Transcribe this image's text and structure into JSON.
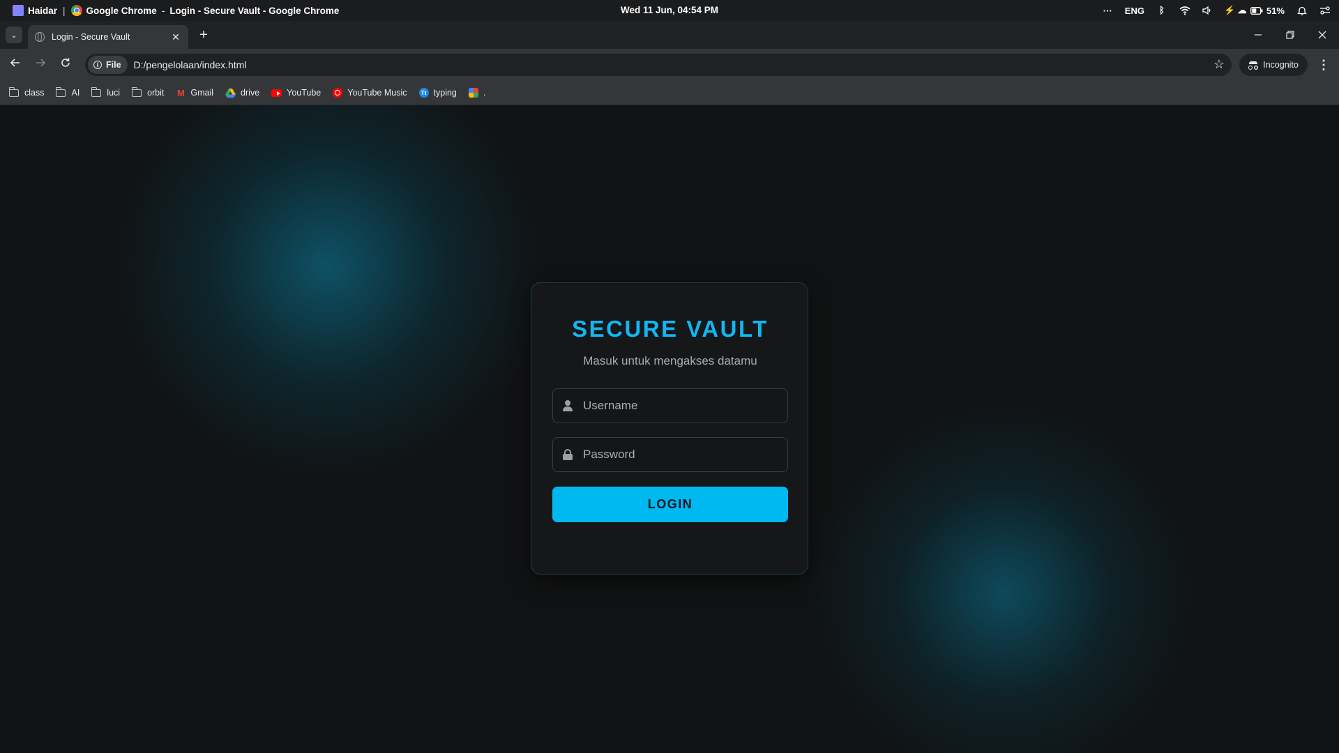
{
  "system_bar": {
    "user": "Haidar",
    "separator": "|",
    "app_name": "Google Chrome",
    "window_title": "Login - Secure Vault - Google Chrome",
    "datetime": "Wed 11 Jun, 04:54 PM",
    "overflow": "···",
    "language": "ENG",
    "battery": "51%"
  },
  "tabs": [
    {
      "title": "Login - Secure Vault",
      "active": true
    }
  ],
  "toolbar": {
    "site_chip": "File",
    "url": "D:/pengelolaan/index.html",
    "incognito_label": "Incognito"
  },
  "bookmarks": [
    {
      "label": "class",
      "icon": "folder-icon"
    },
    {
      "label": "AI",
      "icon": "folder-icon"
    },
    {
      "label": "luci",
      "icon": "folder-icon"
    },
    {
      "label": "orbit",
      "icon": "folder-icon"
    },
    {
      "label": "Gmail",
      "icon": "gmail-icon"
    },
    {
      "label": "drive",
      "icon": "drive-icon"
    },
    {
      "label": "YouTube",
      "icon": "youtube-icon"
    },
    {
      "label": "YouTube Music",
      "icon": "youtube-music-icon"
    },
    {
      "label": "typing",
      "icon": "typing-icon"
    },
    {
      "label": ".",
      "icon": "app-icon"
    }
  ],
  "login": {
    "title": "SECURE VAULT",
    "subtitle": "Masuk untuk mengakses datamu",
    "username_placeholder": "Username",
    "password_placeholder": "Password",
    "button_label": "LOGIN"
  },
  "colors": {
    "accent": "#00b8f0",
    "title": "#12b6f2",
    "background": "#111213",
    "glow": "#0d5c73"
  }
}
